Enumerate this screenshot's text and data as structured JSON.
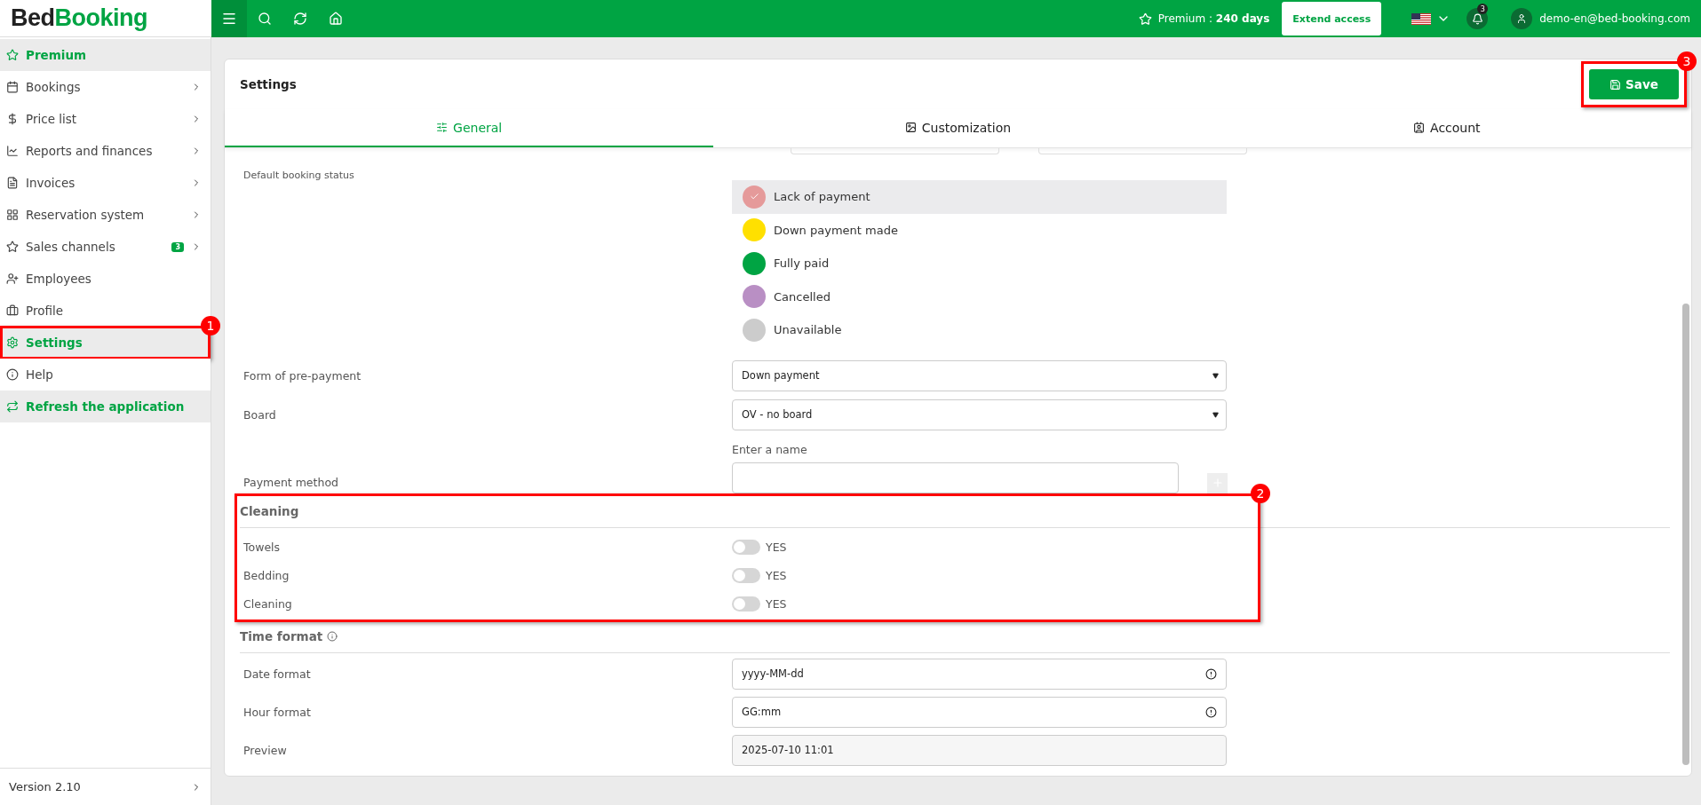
{
  "logo": {
    "first": "Bed",
    "second": "Booking"
  },
  "topbar": {
    "premium": "Premium : **240 days**",
    "extend_button": "Extend access",
    "notifications_count": "3",
    "user_email": "demo-en@bed-booking.com"
  },
  "sidebar": {
    "items": [
      {
        "label": "Premium",
        "kind": "highlight",
        "selected": false,
        "has_submenu": false
      },
      {
        "label": "Bookings",
        "kind": "item",
        "selected": false,
        "has_submenu": true
      },
      {
        "label": "Price list",
        "kind": "item",
        "selected": false,
        "has_submenu": true
      },
      {
        "label": "Reports and finances",
        "kind": "item",
        "selected": false,
        "has_submenu": true
      },
      {
        "label": "Invoices",
        "kind": "item",
        "selected": false,
        "has_submenu": true
      },
      {
        "label": "Reservation system",
        "kind": "item",
        "selected": false,
        "has_submenu": true
      },
      {
        "label": "Sales channels",
        "kind": "item",
        "selected": false,
        "has_submenu": true,
        "badge": "3"
      },
      {
        "label": "Employees",
        "kind": "item",
        "selected": false,
        "has_submenu": false
      },
      {
        "label": "Profile",
        "kind": "item",
        "selected": false,
        "has_submenu": false
      },
      {
        "label": "Settings",
        "kind": "item",
        "selected": true,
        "has_submenu": false,
        "callout": "1"
      },
      {
        "label": "Help",
        "kind": "item",
        "selected": false,
        "has_submenu": false
      },
      {
        "label": "Refresh the application",
        "kind": "highlight",
        "selected": false,
        "has_submenu": false
      }
    ],
    "version": "Version 2.10"
  },
  "card": {
    "title": "Settings",
    "save_button": "Save",
    "save_callout": "3",
    "tabs": [
      {
        "label": "General",
        "selected": true
      },
      {
        "label": "Customization",
        "selected": false
      },
      {
        "label": "Account",
        "selected": false
      }
    ],
    "default_status": {
      "label": "Default booking status",
      "options": [
        {
          "label": "Lack of payment",
          "color": "#e59a9a",
          "selected": true
        },
        {
          "label": "Down payment made",
          "color": "#ffe000",
          "selected": false
        },
        {
          "label": "Fully paid",
          "color": "#00a443",
          "selected": false
        },
        {
          "label": "Cancelled",
          "color": "#b98fc4",
          "selected": false
        },
        {
          "label": "Unavailable",
          "color": "#cccccc",
          "selected": false
        }
      ]
    },
    "selects": [
      {
        "label": "Form of pre-payment",
        "value": "Down payment"
      },
      {
        "label": "Board",
        "value": "OV - no board"
      }
    ],
    "payment_method": {
      "label": "Payment method",
      "hint": "Enter a name"
    },
    "cleaning": {
      "title": "Cleaning",
      "callout": "2",
      "toggles": [
        {
          "label": "Towels",
          "text": "YES",
          "on": false
        },
        {
          "label": "Bedding",
          "text": "YES",
          "on": false
        },
        {
          "label": "Cleaning",
          "text": "YES",
          "on": false
        }
      ]
    },
    "time_format": {
      "title": "Time format",
      "fields": [
        {
          "label": "Date format",
          "value": "yyyy-MM-dd",
          "kind": "editable"
        },
        {
          "label": "Hour format",
          "value": "GG:mm",
          "kind": "editable"
        },
        {
          "label": "Preview",
          "value": "2025-07-10 11:01",
          "kind": "readonly"
        }
      ]
    }
  }
}
